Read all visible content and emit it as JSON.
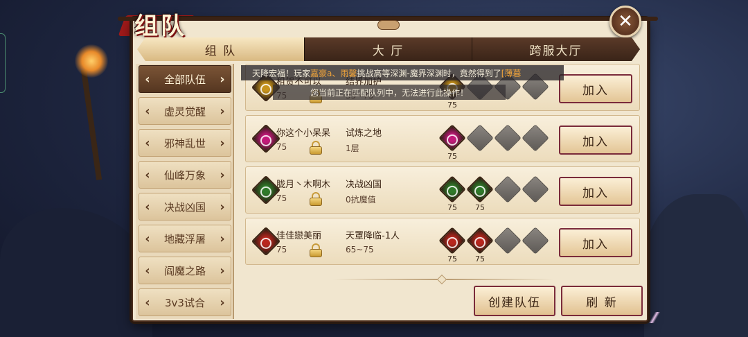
{
  "window": {
    "title": "组队",
    "close_icon": "close-icon"
  },
  "tabs": [
    {
      "label": "组  队",
      "active": true
    },
    {
      "label": "大  厅",
      "active": false
    },
    {
      "label": "跨服大厅",
      "active": false
    }
  ],
  "sidebar": {
    "items": [
      {
        "label": "全部队伍",
        "active": true
      },
      {
        "label": "虚灵觉醒",
        "active": false
      },
      {
        "label": "邪神乱世",
        "active": false
      },
      {
        "label": "仙峰万象",
        "active": false
      },
      {
        "label": "决战凶国",
        "active": false
      },
      {
        "label": "地藏浮屠",
        "active": false
      },
      {
        "label": "阎魔之路",
        "active": false
      },
      {
        "label": "3v3试合",
        "active": false
      }
    ]
  },
  "teams": [
    {
      "leader": "租贺不可以",
      "leader_level": "75",
      "activity": "结界加护",
      "requirement": "35~75",
      "member_levels": [
        "75"
      ],
      "empty_slots": 3,
      "color": "#c7941c",
      "join_label": "加入"
    },
    {
      "leader": "你这个小呆呆",
      "leader_level": "75",
      "activity": "试炼之地",
      "requirement": "1层",
      "member_levels": [
        "75"
      ],
      "empty_slots": 3,
      "color": "#c21a7a",
      "join_label": "加入"
    },
    {
      "leader": "胧月丶木啊木",
      "leader_level": "75",
      "activity": "决战凶国",
      "requirement": "0抗魔值",
      "member_levels": [
        "75",
        "75"
      ],
      "empty_slots": 2,
      "color": "#2f7a2a",
      "join_label": "加入"
    },
    {
      "leader": "佳佳戀美丽",
      "leader_level": "75",
      "activity": "天罩降临-1人",
      "requirement": "65~75",
      "member_levels": [
        "75",
        "75"
      ],
      "empty_slots": 2,
      "color": "#b8261e",
      "join_label": "加入"
    }
  ],
  "bottom": {
    "create_label": "创建队伍",
    "refresh_label": "刷  新"
  },
  "broadcast": {
    "prefix": "天降宏福！玩家",
    "player1": "嘉豪a",
    "sep": "、",
    "player2": "雨馨",
    "middle": "挑战高等深渊-魔界深渊时，竟然得到了",
    "item": "[薄暮"
  },
  "toast": "您当前正在匹配队列中，无法进行此操作！"
}
